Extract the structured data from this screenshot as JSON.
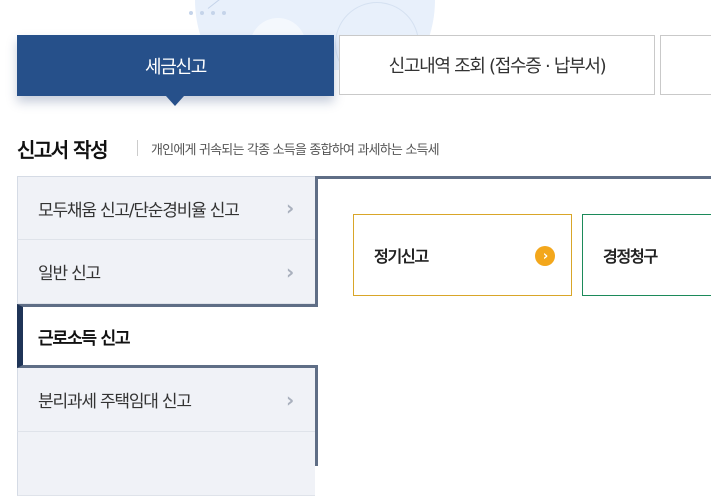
{
  "top_tabs": [
    {
      "label": "세금신고",
      "active": true
    },
    {
      "label": "신고내역 조회 (접수증 · 납부서)",
      "active": false
    },
    {
      "label": "",
      "active": false
    }
  ],
  "section": {
    "title": "신고서 작성",
    "description": "개인에게 귀속되는 각종 소득을 종합하여 과세하는 소득세"
  },
  "side_nav": [
    {
      "label": "모두채움 신고/단순경비율 신고",
      "active": false
    },
    {
      "label": "일반 신고",
      "active": false
    },
    {
      "label": "근로소득 신고",
      "active": true
    },
    {
      "label": "분리과세 주택임대 신고",
      "active": false
    },
    {
      "label": "",
      "active": false
    }
  ],
  "cards": [
    {
      "label": "정기신고",
      "icon": "chevron-right-circle-icon",
      "color": "#d9a629"
    },
    {
      "label": "경정청구",
      "color": "#1c8a5a"
    }
  ],
  "colors": {
    "primary": "#26508a",
    "accent_orange": "#f3a71c",
    "accent_green": "#1c8a5a",
    "nav_border": "#5f6e86"
  }
}
